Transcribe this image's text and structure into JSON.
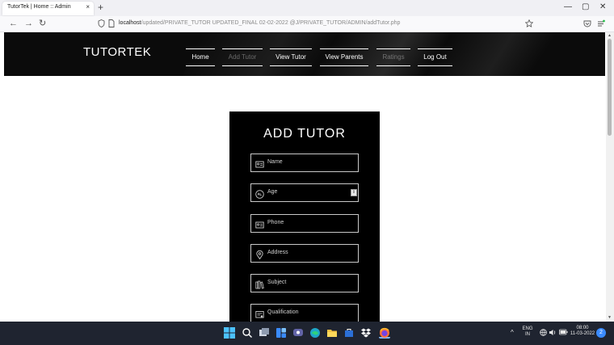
{
  "browser": {
    "tab_title": "TutorTek | Home :: Admin",
    "tab_close": "×",
    "new_tab": "+",
    "window_minimize": "—",
    "window_restore": "▢",
    "window_close": "✕",
    "back": "←",
    "forward": "→",
    "reload": "↻",
    "url_host": "localhost",
    "url_path": "/updated/PRIVATE_TUTOR UPDATED_FINAL 02-02-2022 @J/PRIVATE_TUTOR/ADMIN/addTutor.php"
  },
  "site": {
    "brand": "TUTORTEK",
    "menu": [
      {
        "label": "Home"
      },
      {
        "label": "Add Tutor"
      },
      {
        "label": "View Tutor"
      },
      {
        "label": "View Parents"
      },
      {
        "label": "Ratings"
      },
      {
        "label": "Log Out"
      }
    ]
  },
  "form": {
    "title": "ADD TUTOR",
    "fields": [
      {
        "label": "Name",
        "icon": "id-card-icon"
      },
      {
        "label": "Age",
        "icon": "age-badge-icon"
      },
      {
        "label": "Phone",
        "icon": "id-card-icon"
      },
      {
        "label": "Address",
        "icon": "location-pin-icon"
      },
      {
        "label": "Subject",
        "icon": "books-icon"
      },
      {
        "label": "Qualification",
        "icon": "certificate-icon"
      }
    ]
  },
  "taskbar": {
    "language": "ENG",
    "region": "IN",
    "time": "08:00",
    "date": "11-03-2022",
    "notification_count": "2",
    "colors": {
      "background": "#1f2430",
      "accent": "#3a8bff"
    }
  }
}
